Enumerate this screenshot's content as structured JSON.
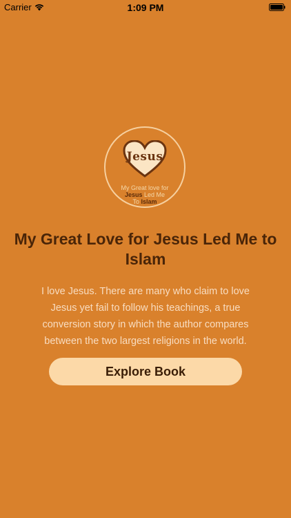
{
  "status_bar": {
    "carrier": "Carrier",
    "time": "1:09 PM"
  },
  "logo": {
    "heart_text": "Jesus",
    "line1": "My Great love for",
    "line2_dark": "Jesus",
    "line2_light": "Led Me",
    "line3_light": "To",
    "line3_dark": "Islam"
  },
  "content": {
    "title": "My Great Love for Jesus Led Me to Islam",
    "description": "I love Jesus. There are many who claim to love Jesus yet fail to follow his teachings, a true conversion story in which the author compares between the two largest religions in the world.",
    "explore_button": "Explore Book"
  },
  "colors": {
    "background": "#d9812c",
    "button": "#fcd9a8",
    "title": "#4a2508"
  }
}
